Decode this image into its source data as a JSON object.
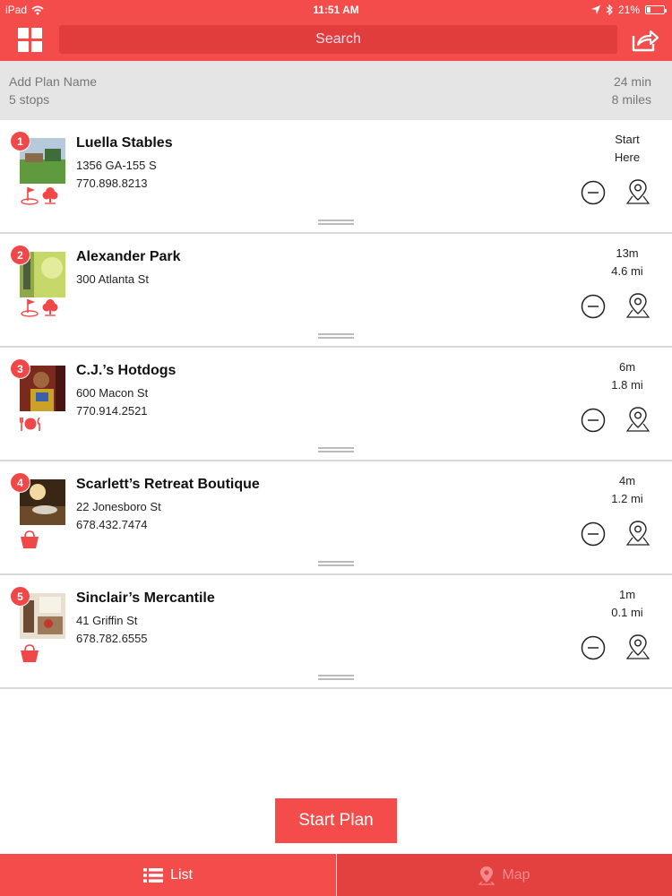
{
  "status_bar": {
    "device": "iPad",
    "time": "11:51 AM",
    "battery": "21%",
    "battery_level": 0.21
  },
  "nav": {
    "search_label": "Search"
  },
  "plan": {
    "name_placeholder": "Add Plan Name",
    "stops": "5 stops",
    "total_time": "24 min",
    "total_distance": "8 miles"
  },
  "stops": [
    {
      "number": "1",
      "name": "Luella Stables",
      "address": "1356 GA-155 S",
      "phone": "770.898.8213",
      "dist_line1": "Start",
      "dist_line2": "Here",
      "categories": [
        "golf-flag-icon",
        "tree-icon"
      ]
    },
    {
      "number": "2",
      "name": "Alexander Park",
      "address": "300 Atlanta St",
      "phone": "",
      "dist_line1": "13m",
      "dist_line2": "4.6 mi",
      "categories": [
        "golf-flag-icon",
        "tree-icon"
      ]
    },
    {
      "number": "3",
      "name": "C.J.’s Hotdogs",
      "address": "600 Macon St",
      "phone": "770.914.2521",
      "dist_line1": "6m",
      "dist_line2": "1.8 mi",
      "categories": [
        "dining-icon"
      ]
    },
    {
      "number": "4",
      "name": "Scarlett’s Retreat Boutique",
      "address": "22 Jonesboro St",
      "phone": "678.432.7474",
      "dist_line1": "4m",
      "dist_line2": "1.2 mi",
      "categories": [
        "shopping-basket-icon"
      ]
    },
    {
      "number": "5",
      "name": "Sinclair’s Mercantile",
      "address": "41 Griffin St",
      "phone": "678.782.6555",
      "dist_line1": "1m",
      "dist_line2": "0.1 mi",
      "categories": [
        "shopping-basket-icon"
      ]
    }
  ],
  "start_button": "Start Plan",
  "tabs": {
    "list": "List",
    "map": "Map"
  },
  "colors": {
    "accent": "#f44b4b",
    "accent_dark": "#e23d3d",
    "header_gray": "#e5e5e5"
  }
}
